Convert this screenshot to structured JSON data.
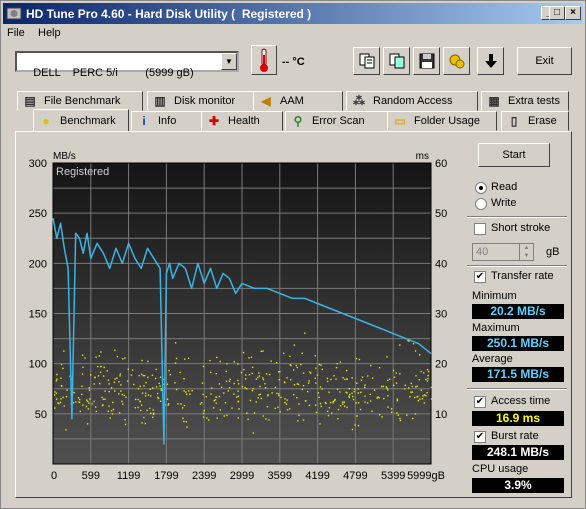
{
  "window": {
    "title": "HD Tune Pro 4.60 - Hard Disk Utility (  Registered )"
  },
  "menu": {
    "file": "File",
    "help": "Help"
  },
  "toolbar": {
    "drive": "DELL    PERC 5/i         (5999 gB)",
    "temperature": "-- °C",
    "exit_label": "Exit"
  },
  "tabs_top": [
    {
      "label": "File Benchmark",
      "icon": "file-benchmark-icon"
    },
    {
      "label": "Disk monitor",
      "icon": "disk-monitor-icon"
    },
    {
      "label": "AAM",
      "icon": "speaker-icon"
    },
    {
      "label": "Random Access",
      "icon": "random-access-icon"
    },
    {
      "label": "Extra tests",
      "icon": "extra-tests-icon"
    }
  ],
  "tabs_bottom": [
    {
      "label": "Benchmark",
      "icon": "bulb-icon"
    },
    {
      "label": "Info",
      "icon": "info-icon"
    },
    {
      "label": "Health",
      "icon": "health-cross-icon"
    },
    {
      "label": "Error Scan",
      "icon": "magnifier-icon"
    },
    {
      "label": "Folder Usage",
      "icon": "folder-icon"
    },
    {
      "label": "Erase",
      "icon": "trash-icon"
    }
  ],
  "side": {
    "start": "Start",
    "read": "Read",
    "write": "Write",
    "short_stroke": "Short stroke",
    "short_stroke_value": "40",
    "gb": "gB",
    "transfer_rate": "Transfer rate",
    "minimum_label": "Minimum",
    "minimum_value": "20.2 MB/s",
    "maximum_label": "Maximum",
    "maximum_value": "250.1 MB/s",
    "average_label": "Average",
    "average_value": "171.5 MB/s",
    "access_time": "Access time",
    "access_time_value": "16.9 ms",
    "burst_rate": "Burst rate",
    "burst_rate_value": "248.1 MB/s",
    "cpu_usage": "CPU usage",
    "cpu_usage_value": "3.9%"
  },
  "colors": {
    "transfer_line": "#3ab4e6",
    "access_dots": "#e8e800",
    "plot_bg": "#2a2a2a",
    "grid": "#7a7a7a"
  },
  "chart_data": {
    "type": "line",
    "watermark": "Registered",
    "y_left_label": "MB/s",
    "y_right_label": "ms",
    "x_ticks": [
      "0",
      "599",
      "1199",
      "1799",
      "2399",
      "2999",
      "3599",
      "4199",
      "4799",
      "5399",
      "5999gB"
    ],
    "y_left_ticks": [
      "300",
      "250",
      "200",
      "150",
      "100",
      "50"
    ],
    "y_right_ticks": [
      "60",
      "50",
      "40",
      "30",
      "20",
      "10"
    ],
    "xlim": [
      0,
      5999
    ],
    "ylim_left": [
      0,
      300
    ],
    "ylim_right": [
      0,
      60
    ],
    "series": [
      {
        "name": "Transfer rate",
        "x": [
          0,
          60,
          120,
          180,
          240,
          300,
          360,
          420,
          480,
          540,
          600,
          700,
          800,
          900,
          1000,
          1100,
          1200,
          1300,
          1400,
          1500,
          1600,
          1700,
          1760,
          1800,
          1850,
          1900,
          2000,
          2100,
          2200,
          2300,
          2400,
          2500,
          2600,
          2700,
          2800,
          2900,
          3000,
          3200,
          3400,
          3600,
          3800,
          4000,
          4200,
          4400,
          4600,
          4800,
          5000,
          5200,
          5400,
          5600,
          5800,
          5999
        ],
        "values": [
          245,
          225,
          240,
          215,
          195,
          45,
          230,
          225,
          210,
          230,
          205,
          220,
          210,
          195,
          215,
          200,
          220,
          205,
          195,
          215,
          205,
          195,
          20,
          190,
          200,
          185,
          200,
          195,
          175,
          200,
          180,
          195,
          175,
          190,
          185,
          170,
          180,
          175,
          175,
          170,
          165,
          165,
          160,
          155,
          150,
          145,
          140,
          135,
          130,
          125,
          120,
          110
        ]
      },
      {
        "name": "Access time",
        "type": "scatter",
        "axis": "right",
        "band_ms": [
          5,
          25
        ],
        "mean_ms": 16.9
      }
    ]
  }
}
